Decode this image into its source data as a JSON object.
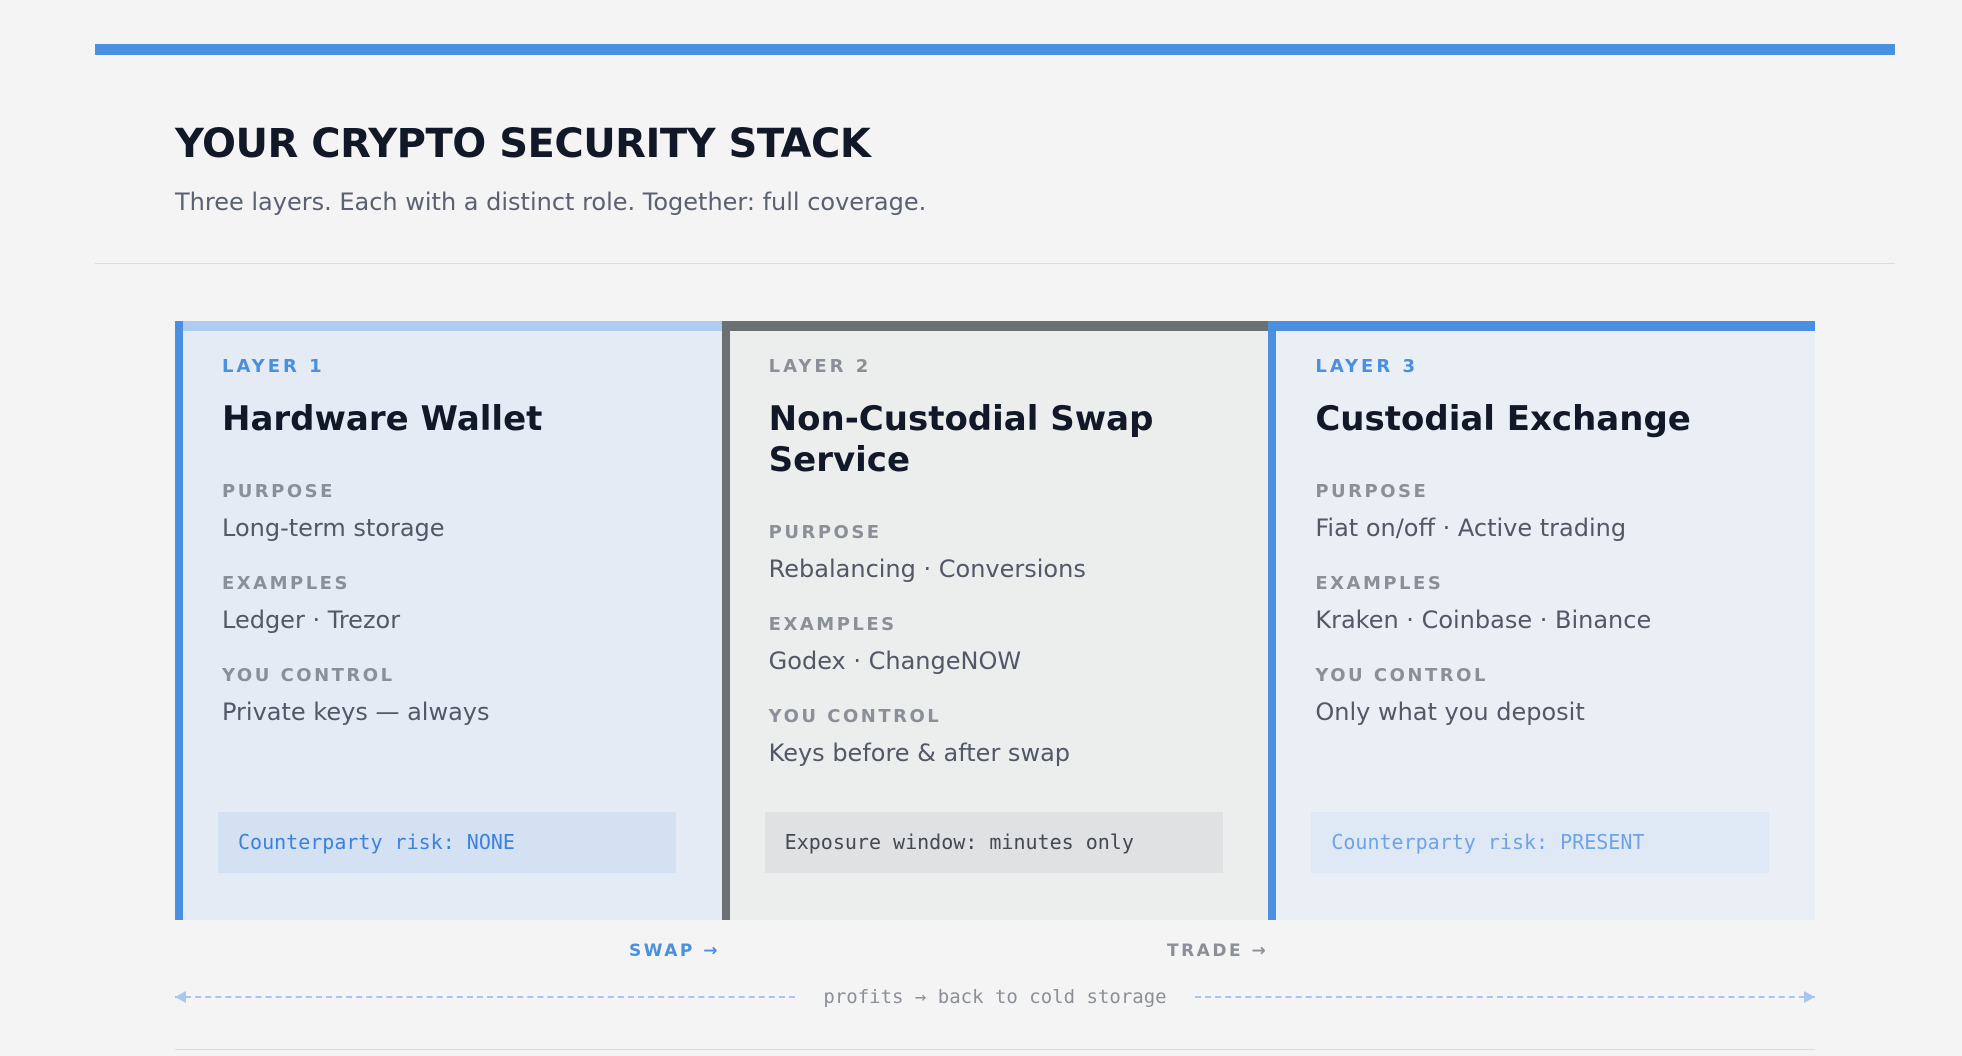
{
  "header": {
    "title": "YOUR CRYPTO SECURITY STACK",
    "subtitle": "Three layers. Each with a distinct role. Together: full coverage."
  },
  "field_labels": {
    "purpose": "PURPOSE",
    "examples": "EXAMPLES",
    "control": "YOU CONTROL"
  },
  "layers": [
    {
      "label": "LAYER 1",
      "title": "Hardware Wallet",
      "purpose": "Long-term storage",
      "examples": "Ledger · Trezor",
      "control": "Private keys — always",
      "badge": "Counterparty risk: NONE"
    },
    {
      "label": "LAYER 2",
      "title": "Non-Custodial Swap Service",
      "purpose": "Rebalancing · Conversions",
      "examples": "Godex · ChangeNOW",
      "control": "Keys before & after swap",
      "badge": "Exposure window: minutes only"
    },
    {
      "label": "LAYER 3",
      "title": "Custodial Exchange",
      "purpose": "Fiat on/off · Active trading",
      "examples": "Kraken · Coinbase · Binance",
      "control": "Only what you deposit",
      "badge": "Counterparty risk: PRESENT"
    }
  ],
  "flow": {
    "swap": "SWAP →",
    "trade": "TRADE →",
    "return": "profits → back to cold storage"
  },
  "colors": {
    "accent": "#4a8fe0",
    "accent_light": "#aecbf0",
    "neutral": "#6b7072",
    "background": "#f4f4f4"
  }
}
